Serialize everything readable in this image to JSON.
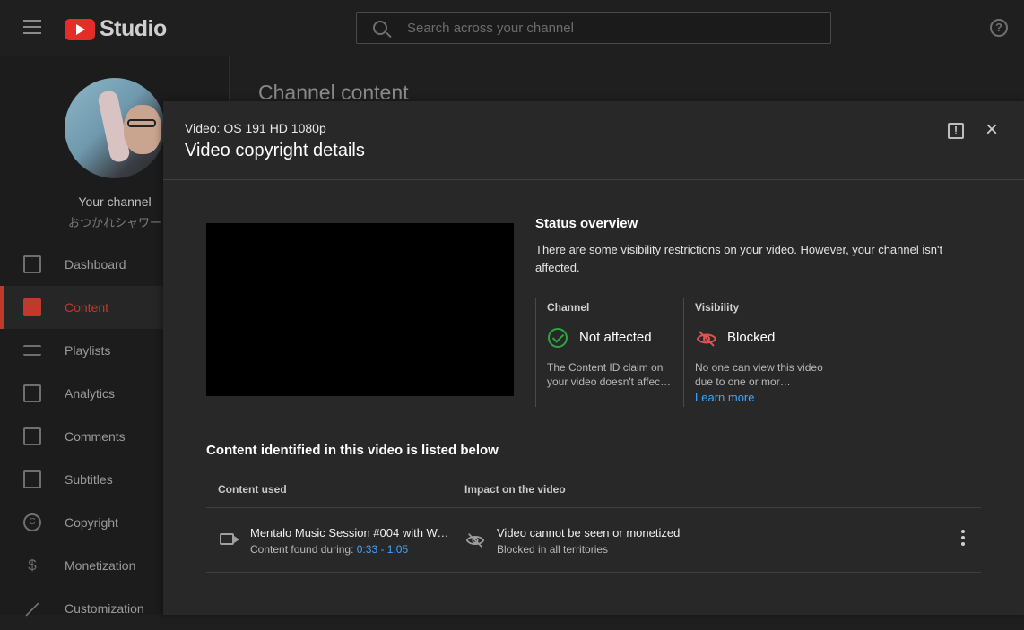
{
  "app": {
    "logo_text": "Studio",
    "search_placeholder": "Search across your channel",
    "help_glyph": "?"
  },
  "sidebar": {
    "channel_title": "Your channel",
    "channel_handle": "おつかれシャワー",
    "items": [
      {
        "label": "Dashboard",
        "icon": "dashboard-icon"
      },
      {
        "label": "Content",
        "icon": "content-icon",
        "active": true
      },
      {
        "label": "Playlists",
        "icon": "playlists-icon"
      },
      {
        "label": "Analytics",
        "icon": "analytics-icon"
      },
      {
        "label": "Comments",
        "icon": "comments-icon"
      },
      {
        "label": "Subtitles",
        "icon": "subtitles-icon"
      },
      {
        "label": "Copyright",
        "icon": "copyright-icon"
      },
      {
        "label": "Monetization",
        "icon": "monetization-icon"
      },
      {
        "label": "Customization",
        "icon": "customization-icon"
      }
    ],
    "copyright_glyph": "C",
    "monetization_glyph": "$"
  },
  "page": {
    "title": "Channel content"
  },
  "modal": {
    "video_label": "Video: OS 191 HD 1080p",
    "title": "Video copyright details",
    "feedback_glyph": "!",
    "close_glyph": "×",
    "status": {
      "title": "Status overview",
      "description": "There are some visibility restrictions on your video. However, your channel isn't affected.",
      "channel": {
        "label": "Channel",
        "value": "Not affected",
        "description": "The Content ID claim on your video doesn't affec…"
      },
      "visibility": {
        "label": "Visibility",
        "value": "Blocked",
        "description": "No one can view this video due to one or mor…",
        "link": "Learn more"
      }
    },
    "identified": {
      "title": "Content identified in this video is listed below",
      "columns": [
        "Content used",
        "Impact on the video"
      ],
      "rows": [
        {
          "title": "Mentalo Music Session #004 with Wa…",
          "found_prefix": "Content found during: ",
          "found_range": "0:33 - 1:05",
          "impact": "Video cannot be seen or monetized",
          "impact_sub": "Blocked in all territories"
        }
      ]
    }
  },
  "colors": {
    "accent_red": "#c0392b",
    "ok_green": "#2ba640",
    "blocked_red": "#e05252",
    "link_blue": "#3ea6ff"
  }
}
